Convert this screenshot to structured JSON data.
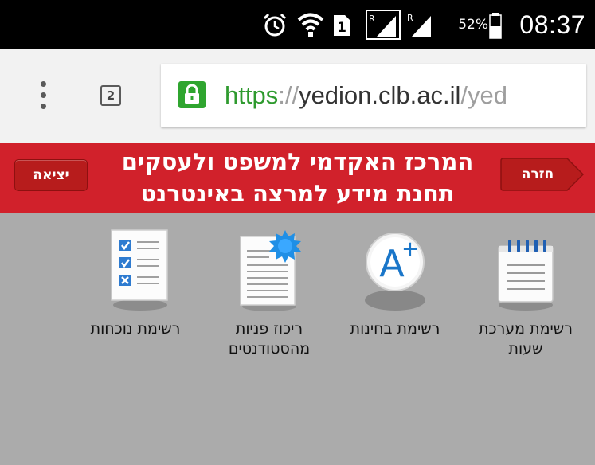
{
  "status_bar": {
    "time": "08:37",
    "battery_percent": "52%",
    "icons": [
      "alarm-icon",
      "wifi-icon",
      "sim-1-icon",
      "signal-roaming-1-icon",
      "signal-roaming-2-icon",
      "battery-icon"
    ]
  },
  "browser": {
    "url": {
      "scheme": "https",
      "separator": "://",
      "host": "yedion.clb.ac.il",
      "path": "/yed"
    },
    "tab_count": "2",
    "icons": [
      "menu-dots-icon",
      "tab-count-icon",
      "lock-icon"
    ]
  },
  "header": {
    "title_line1": "המרכז האקדמי למשפט ולעסקים",
    "title_line2": "תחנת מידע למרצה באינטרנט",
    "back_label": "חזרה",
    "exit_label": "יציאה",
    "background_color": "#d1212b"
  },
  "tiles": [
    {
      "label_line1": "רשימת מערכת",
      "label_line2": "שעות",
      "icon": "notepad-icon"
    },
    {
      "label_line1": "רשימת בחינות",
      "label_line2": "",
      "icon": "grade-a-plus-icon"
    },
    {
      "label_line1": "ריכוז פניות",
      "label_line2": "מהסטודנטים",
      "icon": "document-badge-icon"
    },
    {
      "label_line1": "רשימת נוכחות",
      "label_line2": "",
      "icon": "checklist-icon"
    }
  ]
}
